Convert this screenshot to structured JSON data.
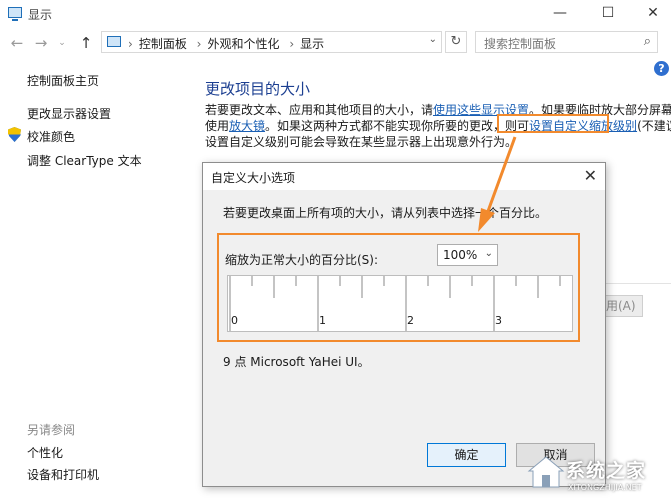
{
  "window": {
    "title": "显示",
    "minimize_glyph": "—",
    "maximize_glyph": "☐",
    "close_glyph": "✕"
  },
  "nav": {
    "breadcrumbs": [
      "控制面板",
      "外观和个性化",
      "显示"
    ],
    "search_placeholder": "搜索控制面板"
  },
  "sidebar": {
    "home": "控制面板主页",
    "items": [
      "更改显示器设置",
      "校准颜色",
      "调整 ClearType 文本"
    ],
    "see_also_title": "另请参阅",
    "see_also": [
      "个性化",
      "设备和打印机"
    ]
  },
  "main": {
    "heading": "更改项目的大小",
    "line1_prefix": "若要更改文本、应用和其他项目的大小，请",
    "line1_link": "使用这些显示设置",
    "line1_suffix": "。如果要临时放大部分屏幕，请",
    "line2_prefix": "使用",
    "line2_link1": "放大镜",
    "line2_mid": "。如果这两种方式都不能实现你所要的更改，则可",
    "line2_link2": "设置自定义缩放级别",
    "line2_suffix": "(不建议)。",
    "line3": "设置自定义级别可能会导致在某些显示器上出现意外行为。",
    "apply_label": "应用(A)"
  },
  "dialog": {
    "title": "自定义大小选项",
    "instruction": "若要更改桌面上所有项的大小，请从列表中选择一个百分比。",
    "scale_label": "缩放为正常大小的百分比(S):",
    "scale_value": "100%",
    "ruler_numbers": [
      "0",
      "1",
      "2",
      "3"
    ],
    "font_info": "9 点 Microsoft YaHei UI。",
    "ok": "确定",
    "cancel": "取消"
  },
  "watermark": {
    "text": "系统之家",
    "sub": "XITONGZHIJIA.NET"
  },
  "colors": {
    "accent_orange": "#f28a2d",
    "link_blue": "#1a5fb4",
    "heading_blue": "#1c3f91"
  }
}
